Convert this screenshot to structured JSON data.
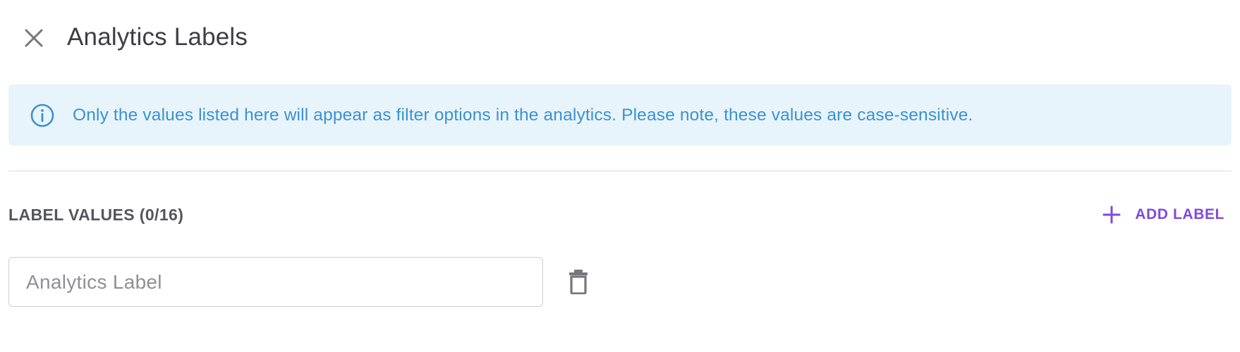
{
  "header": {
    "title": "Analytics Labels",
    "close_icon": "close-icon"
  },
  "info_banner": {
    "icon": "info-icon",
    "text": "Only the values listed here will appear as filter options in the analytics. Please note, these values are case-sensitive.",
    "background_color": "#e8f4fc",
    "text_color": "#3b92cf"
  },
  "label_values": {
    "section_title": "LABEL VALUES (0/16)",
    "add_button": {
      "icon": "plus-icon",
      "label": "ADD LABEL",
      "color": "#7d4bdc"
    },
    "rows": [
      {
        "value": "",
        "placeholder": "Analytics Label",
        "delete_icon": "trash-icon"
      }
    ]
  }
}
